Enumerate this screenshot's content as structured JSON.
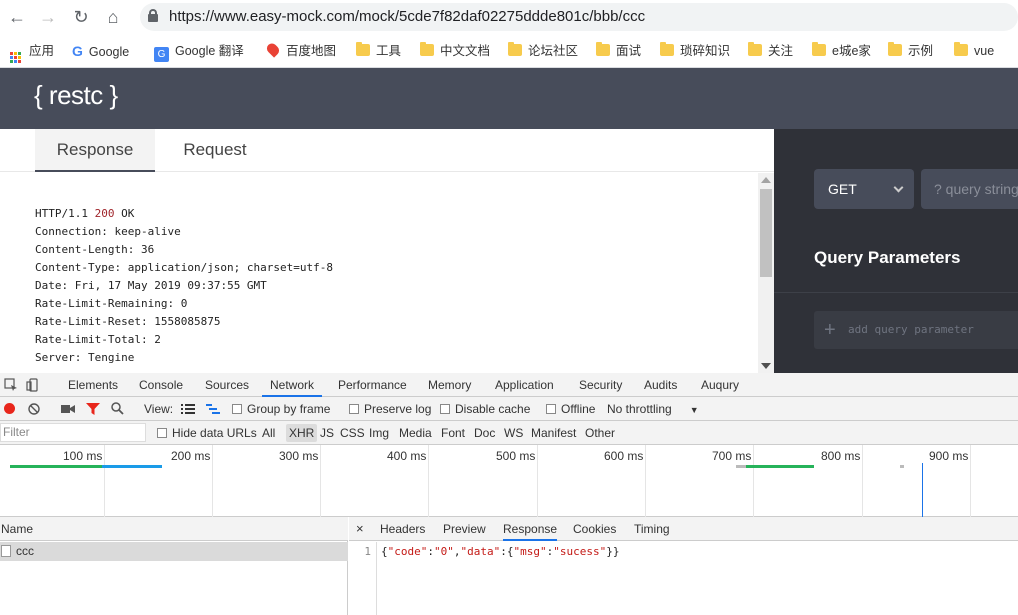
{
  "browser": {
    "url": "https://www.easy-mock.com/mock/5cde7f82daf02275ddde801c/bbb/ccc",
    "bookmarks": [
      "应用",
      "Google",
      "Google 翻译",
      "百度地图",
      "工具",
      "中文文档",
      "论坛社区",
      "面试",
      "琐碎知识",
      "关注",
      "e城e家",
      "示例",
      "vue"
    ]
  },
  "app": {
    "logo": "{ restc }",
    "tabs": {
      "response": "Response",
      "request": "Request"
    },
    "response_headers": [
      {
        "key": "HTTP/1.1",
        "value": "200 OK"
      },
      {
        "key": "Connection:",
        "value": "keep-alive"
      },
      {
        "key": "Content-Length:",
        "value": "36"
      },
      {
        "key": "Content-Type:",
        "value": "application/json; charset=utf-8"
      },
      {
        "key": "Date:",
        "value": "Fri, 17 May 2019 09:37:55 GMT"
      },
      {
        "key": "Rate-Limit-Remaining:",
        "value": "0"
      },
      {
        "key": "Rate-Limit-Reset:",
        "value": "1558085875"
      },
      {
        "key": "Rate-Limit-Total:",
        "value": "2"
      },
      {
        "key": "Server:",
        "value": "Tengine"
      }
    ],
    "method": "GET",
    "query_placeholder": "? query string",
    "query_params_title": "Query Parameters",
    "add_param_placeholder": "add query parameter"
  },
  "devtools": {
    "tabs": [
      "Elements",
      "Console",
      "Sources",
      "Network",
      "Performance",
      "Memory",
      "Application",
      "Security",
      "Audits",
      "Auqury"
    ],
    "active_tab": "Network",
    "toolbar": {
      "view": "View:",
      "group_by_frame": "Group by frame",
      "preserve_log": "Preserve log",
      "disable_cache": "Disable cache",
      "offline": "Offline",
      "throttling": "No throttling"
    },
    "filter": {
      "placeholder": "Filter",
      "hide_data_urls": "Hide data URLs",
      "types": [
        "All",
        "XHR",
        "JS",
        "CSS",
        "Img",
        "Media",
        "Font",
        "Doc",
        "WS",
        "Manifest",
        "Other"
      ],
      "active_type": "XHR"
    },
    "timeline_labels": [
      "100 ms",
      "200 ms",
      "300 ms",
      "400 ms",
      "500 ms",
      "600 ms",
      "700 ms",
      "800 ms",
      "900 ms"
    ],
    "requests": {
      "header": "Name",
      "rows": [
        "ccc"
      ]
    },
    "detail_tabs": [
      "Headers",
      "Preview",
      "Response",
      "Cookies",
      "Timing"
    ],
    "active_detail_tab": "Response",
    "response_line_number": "1",
    "response_body": "{\"code\":\"0\",\"data\":{\"msg\":\"sucess\"}}",
    "colors": {
      "record": "#e8261b",
      "filter_icon": "#e8261b",
      "accent": "#1a73e8"
    }
  }
}
